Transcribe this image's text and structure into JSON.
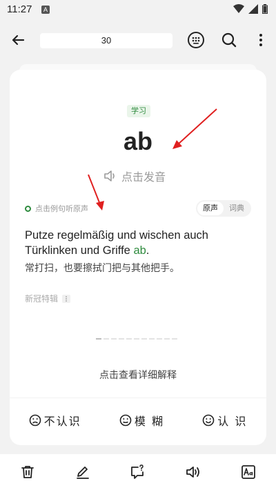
{
  "status": {
    "time": "11:27",
    "app_badge": "A"
  },
  "toolbar": {
    "page_number": "30"
  },
  "card": {
    "tag": "学习",
    "word": "ab",
    "pronounce_label": "点击发音",
    "example_hint": "点击例句听原声",
    "segments": [
      "原声",
      "词典"
    ],
    "sentence_before": "Putze regelmäßig und wischen auch Türklinken und Griffe ",
    "sentence_highlight": "ab",
    "sentence_after": ".",
    "translation": "常打扫，也要擦拭门把与其他把手。",
    "source": "新冠特辑",
    "detail_link": "点击查看详细解释"
  },
  "ratings": [
    {
      "label": "不认识",
      "icon": "sad-face-icon"
    },
    {
      "label": "模 糊",
      "icon": "neutral-face-icon"
    },
    {
      "label": "认 识",
      "icon": "smile-face-icon"
    }
  ],
  "colors": {
    "accent": "#2e8b3e",
    "annotation": "#e02020"
  }
}
